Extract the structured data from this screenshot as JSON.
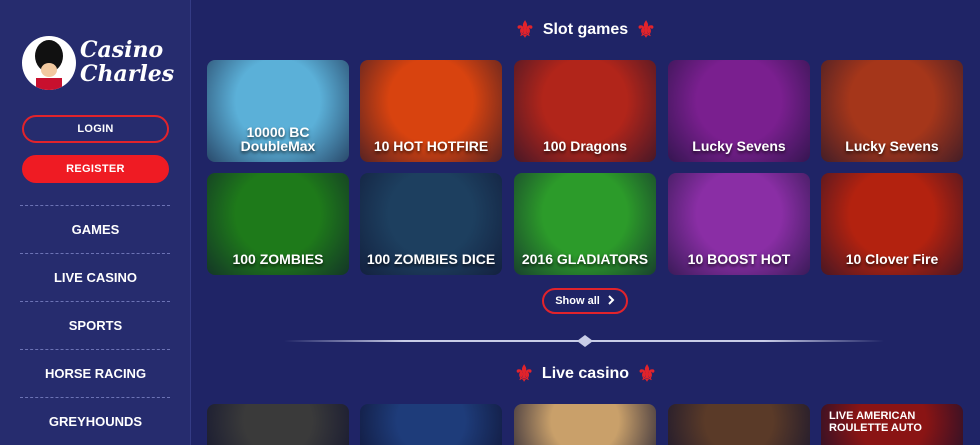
{
  "logo": {
    "line1": "Casino",
    "line2": "Charles"
  },
  "auth": {
    "login_label": "LOGIN",
    "register_label": "REGISTER"
  },
  "nav": {
    "items": [
      {
        "label": "GAMES"
      },
      {
        "label": "LIVE CASINO"
      },
      {
        "label": "SPORTS"
      },
      {
        "label": "HORSE RACING"
      },
      {
        "label": "GREYHOUNDS"
      }
    ]
  },
  "slot_section": {
    "title": "Slot games",
    "show_all_label": "Show all",
    "games": [
      {
        "title": "10000 BC DoubleMax",
        "bg": "#5bb0d8"
      },
      {
        "title": "10 HOT HOTFIRE",
        "bg": "#d8430f"
      },
      {
        "title": "100 Dragons",
        "bg": "#b1251a"
      },
      {
        "title": "Lucky Sevens",
        "bg": "#7a1f8f"
      },
      {
        "title": "Lucky Sevens",
        "bg": "#a5361a"
      },
      {
        "title": "100 ZOMBIES",
        "bg": "#1e7a1a"
      },
      {
        "title": "100 ZOMBIES DICE",
        "bg": "#1d3f5f"
      },
      {
        "title": "2016 GLADIATORS",
        "bg": "#2c9b2a"
      },
      {
        "title": "10 BOOST HOT",
        "bg": "#8a2ea5"
      },
      {
        "title": "10 Clover Fire",
        "bg": "#b3220f"
      }
    ]
  },
  "live_section": {
    "title": "Live casino",
    "games": [
      {
        "title": "",
        "bg": "#3a3a3a"
      },
      {
        "title": "",
        "bg": "#1e3c7a"
      },
      {
        "title": "",
        "bg": "#c9a06a"
      },
      {
        "title": "",
        "bg": "#5a3a28"
      },
      {
        "title": "LIVE AMERICAN ROULETTE AUTO",
        "bg": "#8a1414"
      }
    ]
  }
}
